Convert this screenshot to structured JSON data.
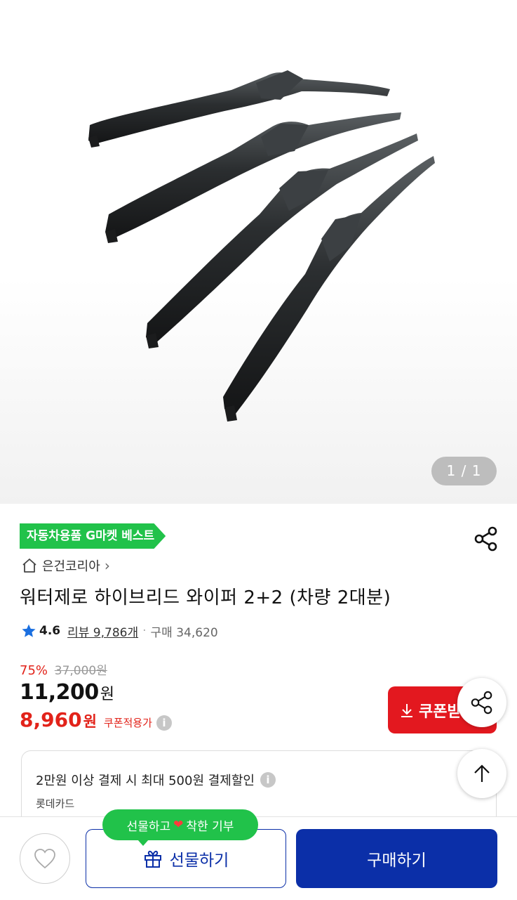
{
  "hero": {
    "image_alt": "워터제로 하이브리드 와이퍼 4개",
    "counter": "1 / 1"
  },
  "best_tag": "자동차용품 G마켓 베스트",
  "store": {
    "name": "은건코리아",
    "arrow": "›"
  },
  "product": {
    "title": "워터제로 하이브리드 와이퍼 2+2 (차량 2대분)"
  },
  "rating": {
    "score": "4.6",
    "review": "리뷰 9,786개",
    "dot": "·",
    "purchases": "구매 34,620"
  },
  "price": {
    "discount_pct": "75%",
    "original": "37,000원",
    "sale": "11,200",
    "sale_unit": "원",
    "coupon_price": "8,960",
    "coupon_unit": "원",
    "coupon_note": "쿠폰적용가",
    "info": "i"
  },
  "coupon_button": {
    "label": "쿠폰받기"
  },
  "card_promo": {
    "text": "2만원 이상 결제 시 최대 500원 결제할인",
    "card": "롯데카드",
    "info": "i"
  },
  "bottom": {
    "gift_bubble_left": "선물하고",
    "gift_bubble_right": "착한 기부",
    "heart": "❤",
    "gift_label": "선물하기",
    "buy_label": "구매하기"
  },
  "colors": {
    "accent_blue": "#0b2fa8",
    "coupon_red": "#e3181f",
    "best_green": "#21c24a",
    "star_blue": "#1a6fe0"
  },
  "icons": [
    "share-icon",
    "home-icon",
    "star-icon",
    "download-icon",
    "up-arrow-icon",
    "heart-icon",
    "gift-icon"
  ]
}
